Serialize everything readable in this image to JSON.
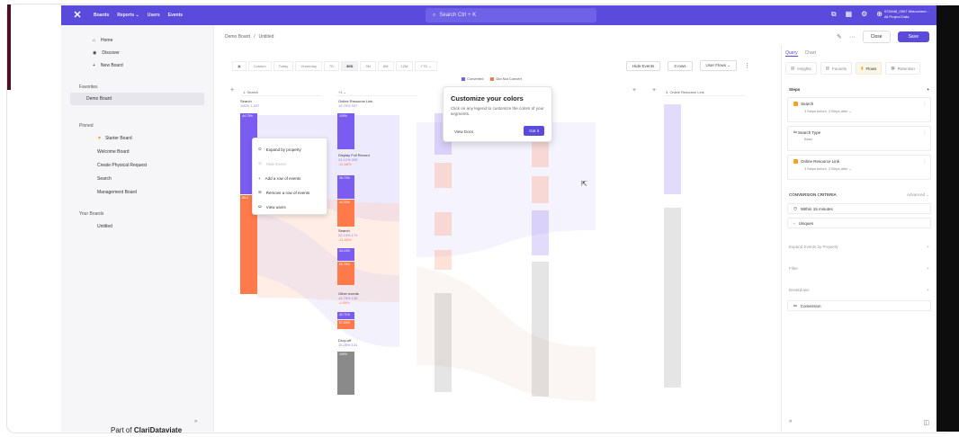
{
  "topbar": {
    "nav": [
      "Boards",
      "Reports ⌄",
      "Users",
      "Events"
    ],
    "search_label": "Search  Ctrl + K",
    "account_name": "972M48_0907 Welcomere...",
    "account_sub": "All Project Data"
  },
  "sidebar": {
    "items": [
      {
        "label": "Home",
        "icon": "home-icon"
      },
      {
        "label": "Discover",
        "icon": "compass-icon"
      },
      {
        "label": "New Board",
        "icon": "plus-icon"
      }
    ],
    "favorites_heading": "Favorites",
    "favorites": [
      "Demo Board"
    ],
    "pinned_heading": "Pinned",
    "pinned": [
      "Starter Board",
      "Welcome Board",
      "Create Physical Request",
      "Search",
      "Management Board"
    ],
    "your_boards_heading": "Your Boards",
    "your_boards": [
      "Untitled"
    ],
    "collapse_label": "»"
  },
  "breadcrumb": {
    "board": "Demo Board",
    "sep": "/",
    "page": "Untitled"
  },
  "actions": {
    "close": "Close",
    "save": "Save"
  },
  "filters": [
    "Custom",
    "Today",
    "Yesterday",
    "7D",
    "30D",
    "3M",
    "6M",
    "12M",
    "YTD ⌄"
  ],
  "filters_selected": "30D",
  "flow_controls": {
    "hide_events": "Hide Events",
    "rows": "3 rows",
    "user_flows": "User Flows ⌄"
  },
  "legend": {
    "converted": "Converted",
    "not_converted": "Did Not Convert"
  },
  "columns": {
    "col1_head": "1. Search",
    "col2_head": "+1 ⌄",
    "col4_head": "3. Online Resource Link"
  },
  "flow": {
    "search_label": "Search",
    "search_pct": "100% 1,337",
    "search_bar_top": "44.73%",
    "search_bar_bot": "55.2",
    "orl_label": "Online Resource Link",
    "orl_pct": "19.79% 337",
    "orl_bar": "100%",
    "dfr_label": "Display Full Record",
    "dfr_pct": "24.12% 395",
    "dfr_delta": "-11.68%",
    "dfr_bar_top": "35.73%",
    "dfr_bar_bot": "44.23%",
    "s2_label": "Search",
    "s2_pct": "20.14% 174",
    "s2_delta": "-11.56%",
    "s2_bar_top": "34.13%",
    "s2_bar_bot": "65.78%",
    "oe_label": "Other events",
    "oe_pct": "14.75% 130",
    "oe_delta": "-4.65%",
    "oe_bar_top": "42.71%",
    "oe_bar_bot": "57.29%",
    "do_label": "Drop-off",
    "do_pct": "15.26% 131",
    "do_bar": "100%"
  },
  "context_menu": [
    "Expand by property",
    "Hide Event",
    "Add a row of events",
    "Remove a row of events",
    "View users"
  ],
  "tooltip": {
    "title": "Customize your colors",
    "body": "Click on any legend to customize the colors of your segments.",
    "docs": "View Docs",
    "got": "Got it"
  },
  "right_panel": {
    "tabs": [
      "Query",
      "Chart"
    ],
    "modes": [
      "Insights",
      "Funnels",
      "Flows",
      "Retention"
    ],
    "steps_heading": "Steps",
    "step1": {
      "label": "Search",
      "meta": "3 Steps before, 3 Steps after ⌄"
    },
    "step2": {
      "label": "Search Type",
      "meta": "Basic"
    },
    "step3": {
      "label": "Online Resource Link",
      "meta": "3 Steps before, 3 Steps after ⌄"
    },
    "conv_heading": "CONVERSION CRITERIA",
    "conv_adv": "Advanced ⌄",
    "within": "Within 15 minutes",
    "uniques": "Uniques",
    "expand": "Expand Events by Property",
    "filter": "Filter",
    "breakdown": "Breakdown",
    "conversion": "Conversion"
  },
  "caption": {
    "prefix": "Part of",
    "bold": "ClariDataviate"
  },
  "colors": {
    "brand": "#5a4bdc",
    "converted": "#7b5cf0",
    "not_converted": "#ff7a4a",
    "dropoff": "#8a8a8a"
  }
}
